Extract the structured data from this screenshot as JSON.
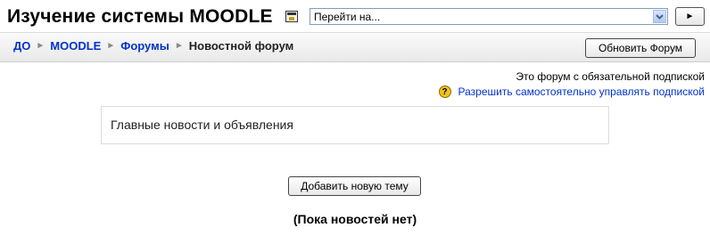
{
  "header": {
    "site_title": "Изучение системы MOODLE",
    "jump_select_value": "Перейти на...",
    "go_button_label": "►"
  },
  "navbar": {
    "breadcrumb": [
      "ДО",
      "MOODLE",
      "Форумы",
      "Новостной форум"
    ],
    "separator": "►",
    "update_button_label": "Обновить Форум"
  },
  "subscription": {
    "status_text": "Это форум с обязательной подпиской",
    "help_icon": "?",
    "link_text": "Разрешить самостоятельно управлять подпиской"
  },
  "forum": {
    "intro": "Главные новости и объявления",
    "add_button_label": "Добавить новую тему",
    "empty_text": "(Пока новостей нет)"
  },
  "colors": {
    "link": "#0033cc",
    "help_icon": "#f2c21a"
  }
}
